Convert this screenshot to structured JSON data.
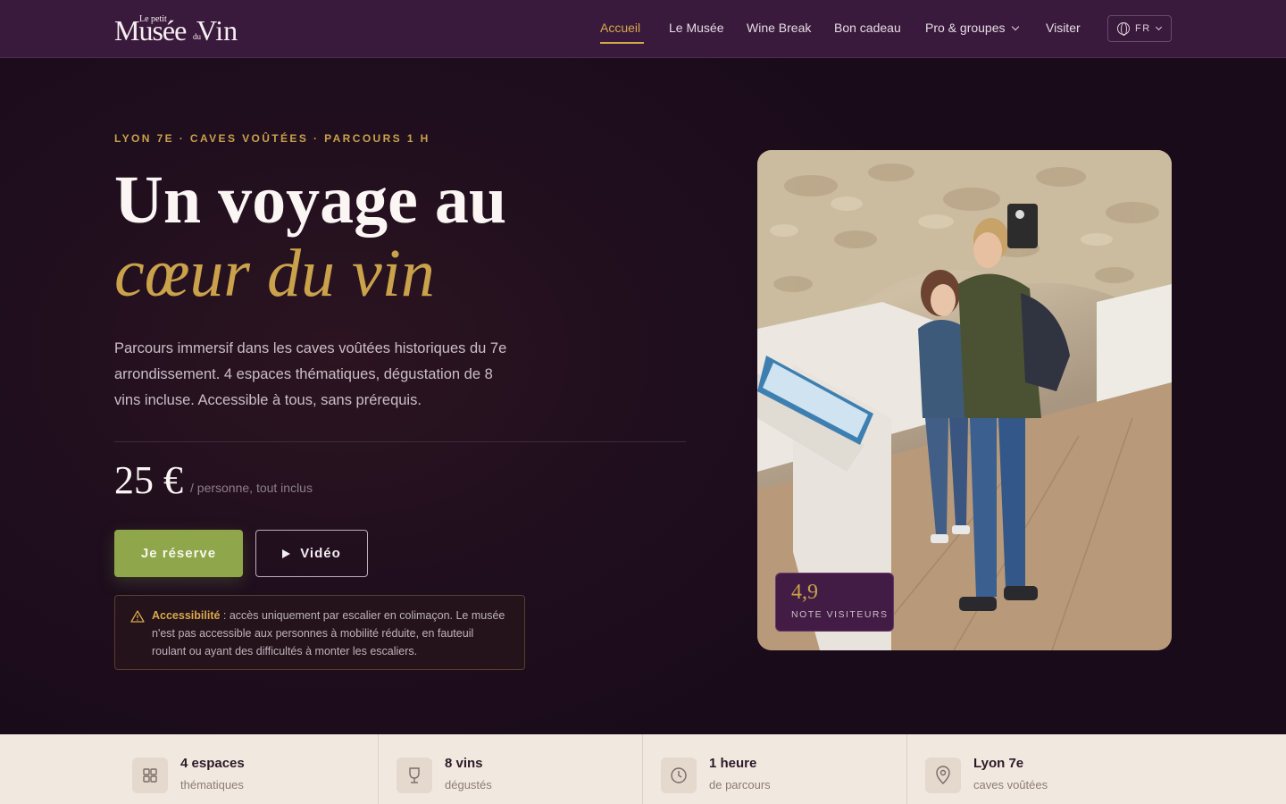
{
  "brand": {
    "logo_small": "Le petit",
    "logo_main": "Musée",
    "logo_du": "du",
    "logo_vin": "Vin"
  },
  "nav": {
    "items": [
      {
        "label": "Accueil",
        "active": true
      },
      {
        "label": "Le Musée"
      },
      {
        "label": "Wine Break"
      },
      {
        "label": "Bon cadeau"
      },
      {
        "label": "Pro & groupes",
        "dropdown": true
      },
      {
        "label": "Visiter"
      }
    ],
    "language": "FR"
  },
  "hero": {
    "eyebrow": "LYON 7E · CAVES VOÛTÉES · PARCOURS 1 H",
    "title_line1": "Un voyage au",
    "title_line2": "cœur du vin",
    "lead": "Parcours immersif dans les caves voûtées historiques du 7e arrondissement. 4 espaces thématiques, dégustation de 8 vins incluse. Accessible à tous, sans prérequis.",
    "price": "25 €",
    "price_note": "/ personne, tout inclus",
    "cta_primary": "Je réserve",
    "cta_secondary": "Vidéo",
    "notice_label": "Accessibilité",
    "notice_text": " : accès uniquement par escalier en colimaçon. Le musée n'est pas accessible aux personnes à mobilité réduite, en fauteuil roulant ou ayant des difficultés à monter les escaliers.",
    "rating_value": "4,9",
    "rating_label": "NOTE VISITEURS"
  },
  "stats": [
    {
      "icon": "grid-icon",
      "main": "4 espaces",
      "sub": "thématiques"
    },
    {
      "icon": "wine-glass-icon",
      "main": "8 vins",
      "sub": "dégustés"
    },
    {
      "icon": "clock-icon",
      "main": "1 heure",
      "sub": "de parcours"
    },
    {
      "icon": "map-pin-icon",
      "main": "Lyon 7e",
      "sub": "caves voûtées"
    }
  ],
  "colors": {
    "accent_gold": "#c9a24b",
    "header": "#3a1a3c",
    "cta_green": "#8fa64a",
    "stats_bg": "#f1e9df"
  }
}
